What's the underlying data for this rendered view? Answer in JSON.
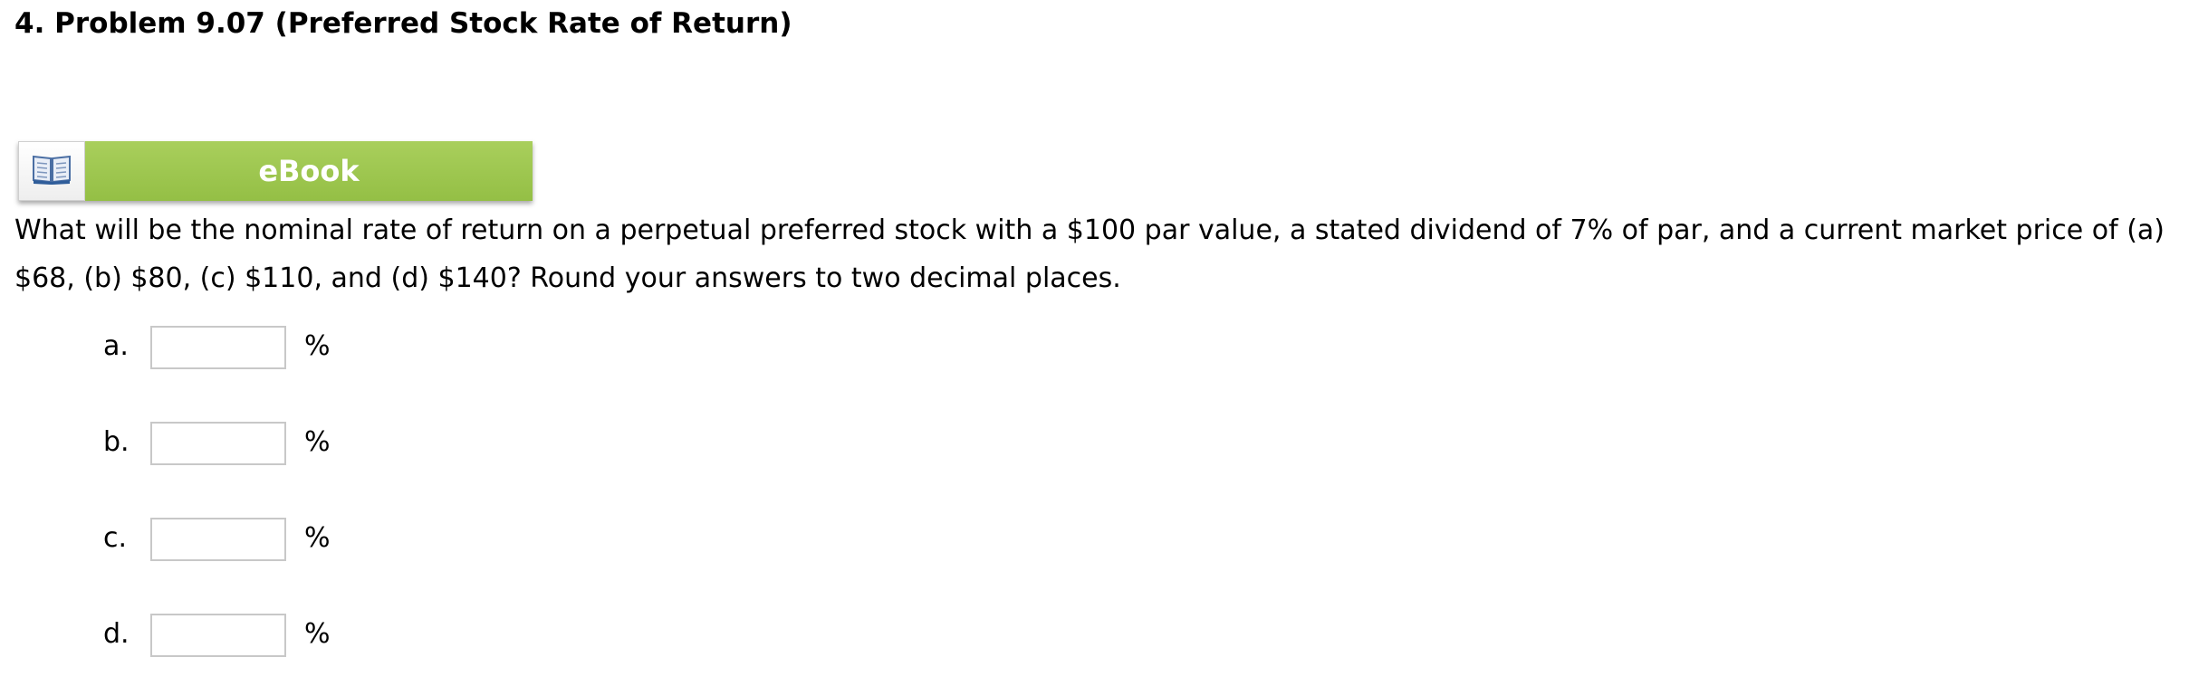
{
  "problem": {
    "title": "4.  Problem 9.07 (Preferred Stock Rate of Return)"
  },
  "ebook": {
    "icon": "open-book-icon",
    "label": "eBook",
    "color": "#9dc64f"
  },
  "question": {
    "text": "What will be the nominal rate of return on a perpetual preferred stock with a $100 par value, a stated dividend of 7% of par, and a current market price of (a) $68, (b) $80, (c) $110, and (d) $140? Round your answers to two decimal places."
  },
  "answers": [
    {
      "label": "a.",
      "value": "",
      "unit": "%"
    },
    {
      "label": "b.",
      "value": "",
      "unit": "%"
    },
    {
      "label": "c.",
      "value": "",
      "unit": "%"
    },
    {
      "label": "d.",
      "value": "",
      "unit": "%"
    }
  ]
}
